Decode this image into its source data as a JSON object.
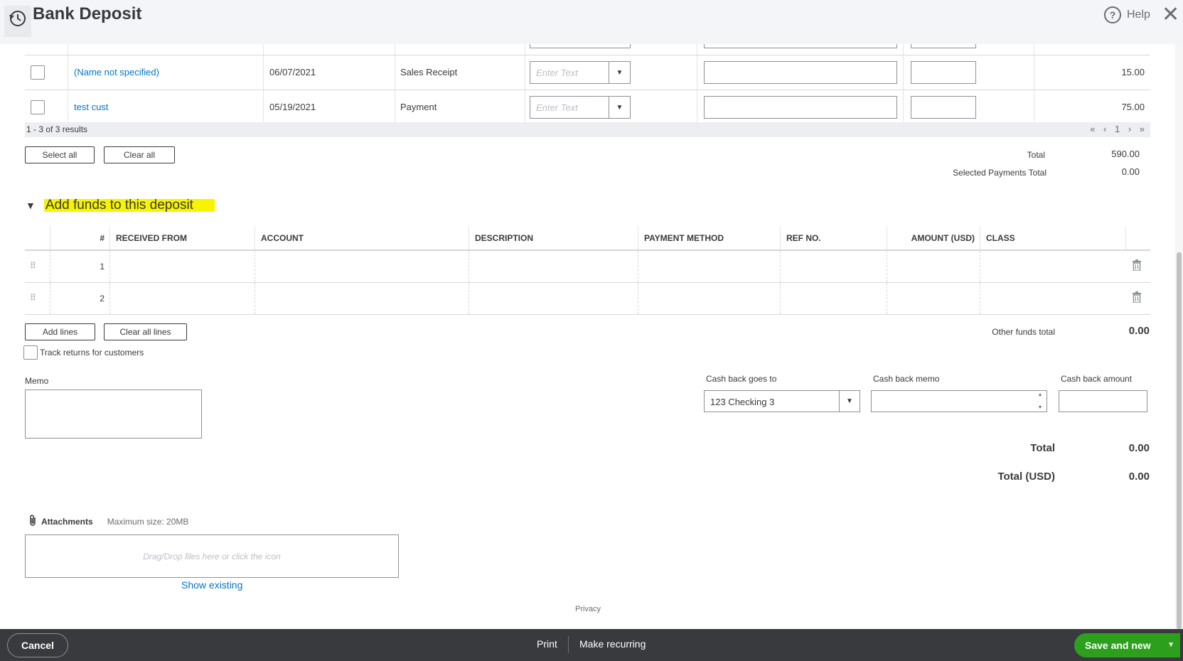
{
  "header": {
    "title": "Bank Deposit",
    "help_label": "Help"
  },
  "payments": {
    "rows": [
      {
        "name": "(Name not specified)",
        "date": "06/07/2021",
        "type": "Sales Receipt",
        "method_placeholder": "Enter Text",
        "amount": "15.00"
      },
      {
        "name": "test cust",
        "date": "05/19/2021",
        "type": "Payment",
        "method_placeholder": "Enter Text",
        "amount": "75.00"
      }
    ],
    "results_text": "1 - 3 of 3 results",
    "pager": "« ‹ 1 › »",
    "select_all_label": "Select all",
    "clear_all_label": "Clear all",
    "total_label": "Total",
    "total_value": "590.00",
    "selected_total_label": "Selected Payments Total",
    "selected_total_value": "0.00"
  },
  "funds": {
    "section_title": "Add funds to this deposit",
    "columns": [
      "#",
      "RECEIVED FROM",
      "ACCOUNT",
      "DESCRIPTION",
      "PAYMENT METHOD",
      "REF NO.",
      "AMOUNT (USD)",
      "CLASS"
    ],
    "rows": [
      {
        "num": "1"
      },
      {
        "num": "2"
      }
    ],
    "add_lines_label": "Add lines",
    "clear_all_lines_label": "Clear all lines",
    "other_funds_label": "Other funds total",
    "other_funds_value": "0.00",
    "track_returns_label": "Track returns for customers"
  },
  "memo": {
    "label": "Memo"
  },
  "cashback": {
    "goes_to_label": "Cash back goes to",
    "goes_to_value": "123 Checking 3",
    "memo_label": "Cash back memo",
    "amount_label": "Cash back amount"
  },
  "totals": {
    "total_label": "Total",
    "total_value": "0.00",
    "total_usd_label": "Total (USD)",
    "total_usd_value": "0.00"
  },
  "attachments": {
    "label": "Attachments",
    "max_size": "Maximum size: 20MB",
    "drop_text": "Drag/Drop files here or click the icon",
    "show_existing": "Show existing"
  },
  "privacy": "Privacy",
  "footer": {
    "cancel_label": "Cancel",
    "print_label": "Print",
    "make_recurring_label": "Make recurring",
    "save_new_label": "Save and new"
  }
}
